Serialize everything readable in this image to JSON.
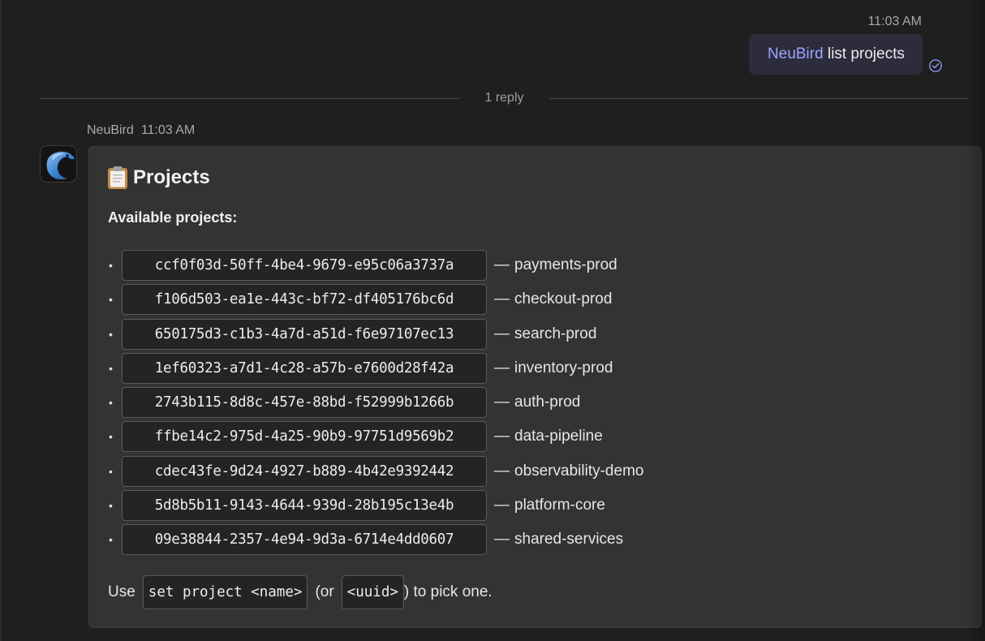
{
  "outgoing": {
    "time": "11:03 AM",
    "mention": "NeuBird",
    "text": " list projects",
    "status_icon": "read-receipt-check-icon"
  },
  "thread": {
    "reply_count_label": "1 reply"
  },
  "bot_message": {
    "sender": "NeuBird",
    "time": "11:03 AM",
    "avatar_icon": "neubird-bird-logo",
    "title_icon": "clipboard-icon",
    "title": "Projects",
    "subtitle": "Available projects:",
    "bullet": "•",
    "separator": "—",
    "projects": [
      {
        "uuid": "ccf0f03d-50ff-4be4-9679-e95c06a3737a",
        "name": "payments-prod"
      },
      {
        "uuid": "f106d503-ea1e-443c-bf72-df405176bc6d",
        "name": "checkout-prod"
      },
      {
        "uuid": "650175d3-c1b3-4a7d-a51d-f6e97107ec13",
        "name": "search-prod"
      },
      {
        "uuid": "1ef60323-a7d1-4c28-a57b-e7600d28f42a",
        "name": "inventory-prod"
      },
      {
        "uuid": "2743b115-8d8c-457e-88bd-f52999b1266b",
        "name": "auth-prod"
      },
      {
        "uuid": "ffbe14c2-975d-4a25-90b9-97751d9569b2",
        "name": "data-pipeline"
      },
      {
        "uuid": "cdec43fe-9d24-4927-b889-4b42e9392442",
        "name": "observability-demo"
      },
      {
        "uuid": "5d8b5b11-9143-4644-939d-28b195c13e4b",
        "name": "platform-core"
      },
      {
        "uuid": "09e38844-2357-4e94-9d3a-6714e4dd0607",
        "name": "shared-services"
      }
    ],
    "footer": {
      "prefix": "Use",
      "command": "set project <name>",
      "middle": "(or",
      "alt_command": "<uuid>",
      "suffix": ") to pick one."
    }
  },
  "colors": {
    "background": "#1f1f1f",
    "card": "#333333",
    "outgoing_bubble": "#2c2c3c",
    "mention": "#9ea3ff",
    "code_background": "#242424"
  }
}
